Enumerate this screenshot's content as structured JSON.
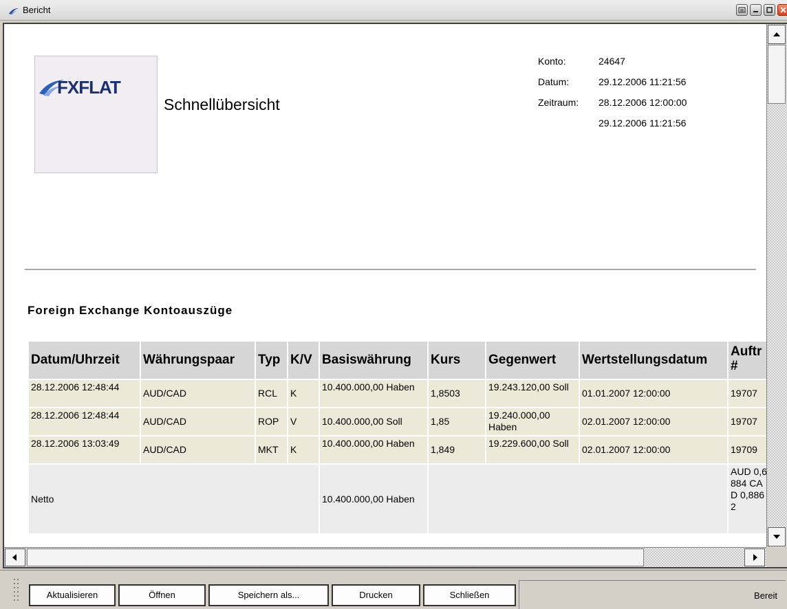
{
  "window": {
    "title": "Bericht"
  },
  "report": {
    "logo_text": "FXFLAT",
    "title": "Schnellübersicht",
    "meta": [
      {
        "label": "Konto:",
        "value": "24647"
      },
      {
        "label": "Datum:",
        "value": "29.12.2006 11:21:56"
      },
      {
        "label": "Zeitraum:",
        "value": "28.12.2006 12:00:00"
      },
      {
        "label": "",
        "value": "29.12.2006 11:21:56"
      }
    ],
    "section_title": "Foreign Exchange Kontoauszüge"
  },
  "table": {
    "headers": [
      "Datum/Uhrzeit",
      "Währungspaar",
      "Typ",
      "K/V",
      "Basiswährung",
      "Kurs",
      "Gegenwert",
      "Wertstellungsdatum",
      "Auftr #"
    ],
    "rows": [
      [
        "28.12.2006 12:48:44",
        "AUD/CAD",
        "RCL",
        "K",
        "10.400.000,00 Haben",
        "1,8503",
        "19.243.120,00 Soll",
        "01.01.2007 12:00:00",
        "19707"
      ],
      [
        "28.12.2006 12:48:44",
        "AUD/CAD",
        "ROP",
        "V",
        "10.400.000,00 Soll",
        "1,85",
        "19.240.000,00 Haben",
        "02.01.2007 12:00:00",
        "19707"
      ],
      [
        "28.12.2006 13:03:49",
        "AUD/CAD",
        "MKT",
        "K",
        "10.400.000,00 Haben",
        "1,849",
        "19.229.600,00 Soll",
        "02.01.2007 12:00:00",
        "19709"
      ]
    ],
    "net": {
      "label": "Netto",
      "base": "10.400.000,00 Haben",
      "last": "AUD 0,6884 CAD 0,8862"
    }
  },
  "toolbar": {
    "buttons": [
      "Aktualisieren",
      "Öffnen",
      "Speichern als...",
      "Drucken",
      "Schließen"
    ],
    "status": "Bereit"
  },
  "colors": {
    "row_bg": "#ece9d8",
    "header_bg": "#d6d6d6",
    "net_bg": "#ececec",
    "logo_blue": "#1d2f6d"
  }
}
